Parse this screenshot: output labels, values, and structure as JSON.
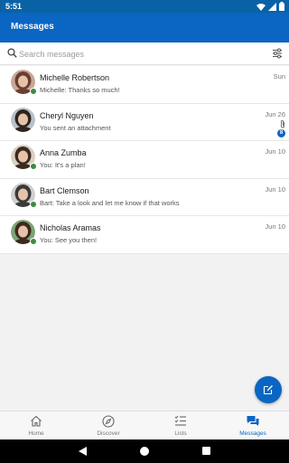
{
  "status_bar": {
    "time": "5:51"
  },
  "app_bar": {
    "title": "Messages"
  },
  "search": {
    "placeholder": "Search messages",
    "value": ""
  },
  "conversations": [
    {
      "name": "Michelle Robertson",
      "preview": "Michelle: Thanks so much!",
      "date": "Sun",
      "online": true,
      "attachment": false,
      "unread": null,
      "avatar_bg": "#c9a89a",
      "avatar_fg": "#6b3f2f"
    },
    {
      "name": "Cheryl Nguyen",
      "preview": "You sent an attachment",
      "date": "Jun 26",
      "online": false,
      "attachment": true,
      "unread": "8",
      "avatar_bg": "#b8c2c8",
      "avatar_fg": "#2f2420"
    },
    {
      "name": "Anna Zumba",
      "preview": "You: It's a plan!",
      "date": "Jun 10",
      "online": true,
      "attachment": false,
      "unread": null,
      "avatar_bg": "#d9d0c2",
      "avatar_fg": "#3b2a20"
    },
    {
      "name": "Bart Clemson",
      "preview": "Bart: Take a look and let me know if that works",
      "date": "Jun 10",
      "online": true,
      "attachment": false,
      "unread": null,
      "avatar_bg": "#cfcfcf",
      "avatar_fg": "#3a3a3a"
    },
    {
      "name": "Nicholas Aramas",
      "preview": "You: See you then!",
      "date": "Jun 10",
      "online": true,
      "attachment": false,
      "unread": null,
      "avatar_bg": "#7fa37a",
      "avatar_fg": "#3d2a1c"
    }
  ],
  "bottom_nav": [
    {
      "label": "Home",
      "icon": "home-icon",
      "active": false
    },
    {
      "label": "Discover",
      "icon": "compass-icon",
      "active": false
    },
    {
      "label": "Lists",
      "icon": "checklist-icon",
      "active": false
    },
    {
      "label": "Messages",
      "icon": "chat-bubbles-icon",
      "active": true
    }
  ],
  "colors": {
    "brand": "#0a66c2",
    "presence": "#3d8b40"
  }
}
